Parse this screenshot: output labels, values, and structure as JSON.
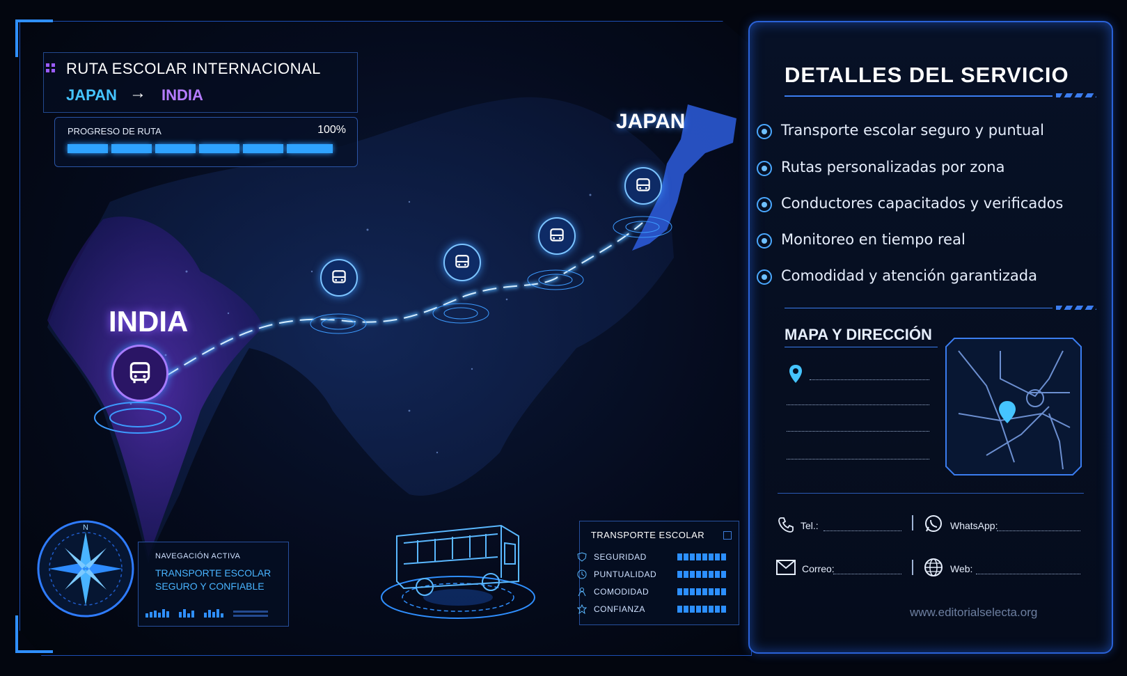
{
  "header": {
    "title": "RUTA ESCOLAR INTERNACIONAL",
    "origin": "JAPAN",
    "arrow": "→",
    "destination": "INDIA"
  },
  "progress": {
    "label": "PROGRESO DE RUTA",
    "value_text": "100%",
    "value": 1.0
  },
  "map": {
    "label_india": "INDIA",
    "label_japan": "JAPAN",
    "stops": [
      "bus-icon",
      "bus-icon",
      "bus-icon",
      "bus-icon",
      "bus-icon"
    ]
  },
  "navigation": {
    "compass_letter": "N",
    "label": "NAVEGACIÓN ACTIVA",
    "line1": "TRANSPORTE ESCOLAR",
    "line2": "SEGURO Y CONFIABLE"
  },
  "stats": {
    "title": "TRANSPORTE ESCOLAR",
    "rows": [
      {
        "label": "SEGURIDAD",
        "icon": "shield-icon"
      },
      {
        "label": "PUNTUALIDAD",
        "icon": "clock-icon"
      },
      {
        "label": "COMODIDAD",
        "icon": "seat-icon"
      },
      {
        "label": "CONFIANZA",
        "icon": "badge-icon"
      }
    ]
  },
  "details": {
    "title": "DETALLES DEL SERVICIO",
    "features": [
      "Transporte escolar seguro y puntual",
      "Rutas personalizadas por zona",
      "Conductores capacitados y verificados",
      "Monitoreo en tiempo real",
      "Comodidad y atención garantizada"
    ]
  },
  "map_section": {
    "title": "MAPA Y DIRECCIÓN"
  },
  "contact": {
    "tel_label": "Tel.:",
    "whatsapp_label": "WhatsApp:",
    "email_label": "Correo:",
    "web_label": "Web:",
    "website": "www.editorialselecta.org"
  },
  "colors": {
    "accent": "#2fa3ff",
    "purple": "#9b5cff",
    "cyan": "#45c4ff",
    "background": "#03060f"
  }
}
